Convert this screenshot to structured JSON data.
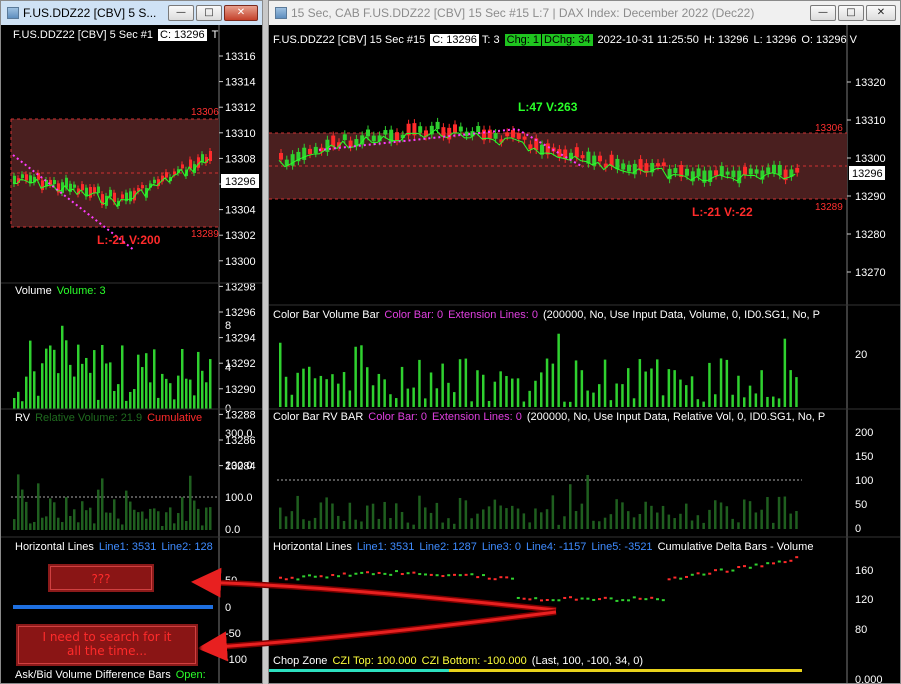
{
  "left_window": {
    "title": "F.US.DDZ22 [CBV]  5 S...",
    "header": {
      "symbol": "F.US.DDZ22 [CBV]  5 Sec   #1",
      "close": "C: 13296",
      "cut": "T"
    },
    "price_axis": [
      "13316",
      "13314",
      "13312",
      "13310",
      "13308",
      "13306",
      "13304",
      "13302",
      "13300",
      "13298",
      "13296",
      "13294",
      "13292",
      "13290",
      "13288",
      "13286",
      "13284"
    ],
    "current_price": "13296",
    "line_label_top": "13306",
    "line_label_bottom": "13289",
    "low_label": "L:-21 V:200",
    "volume": {
      "label": "Volume",
      "value": "Volume: 3",
      "axis": [
        "8",
        "4",
        "0"
      ]
    },
    "rv": {
      "label": "RV",
      "value": "Relative Volume: 21.9",
      "cumulative": "Cumulative",
      "axis": [
        "300.0",
        "200.0",
        "100.0",
        "0.0"
      ]
    },
    "hlines": {
      "label": "Horizontal Lines",
      "line1": "Line1: 3531",
      "line2": "Line2: 128",
      "axis": [
        "50",
        "0",
        "-50",
        "-100"
      ]
    },
    "footer": {
      "label": "Ask/Bid Volume Difference Bars",
      "value": "Open:"
    }
  },
  "right_window": {
    "title": "15 Sec, CAB F.US.DDZ22 [CBV]  15 Sec   #15 L:7 | DAX Index: December 2022 (Dec22)",
    "header": {
      "symbol": "F.US.DDZ22 [CBV]  15 Sec   #15",
      "close": "C: 13296",
      "trades": "T: 3",
      "chg": "Chg: 1",
      "dchg": "DChg: 34",
      "datetime": "2022-10-31  11:25:50",
      "high": "H: 13296",
      "low": "L: 13296",
      "open": "O: 13296 V"
    },
    "price_axis": [
      "13320",
      "13310",
      "13300",
      "13290",
      "13280",
      "13270"
    ],
    "current_price": "13296",
    "line_label_top": "13306",
    "line_label_bottom": "13289",
    "high_label": "L:47 V:263",
    "low_label": "L:-21 V:-22",
    "cbvb": {
      "label": "Color Bar Volume Bar",
      "colorbar": "Color Bar: 0",
      "ext": "Extension Lines: 0",
      "params": "(200000, No, Use Input Data, Volume, 0, ID0.SG1, No, P",
      "axis": [
        "20"
      ]
    },
    "cbrv": {
      "label": "Color Bar RV BAR",
      "colorbar": "Color Bar: 0",
      "ext": "Extension Lines: 0",
      "params": "(200000, No, Use Input Data, Relative Vol, 0, ID0.SG1, No, P",
      "axis": [
        "200",
        "150",
        "100",
        "50",
        "0"
      ]
    },
    "hlines": {
      "label": "Horizontal Lines",
      "l1": "Line1: 3531",
      "l2": "Line2: 1287",
      "l3": "Line3: 0",
      "l4": "Line4: -1157",
      "l5": "Line5: -3521",
      "cum": "Cumulative Delta Bars - Volume",
      "axis": [
        "160",
        "120",
        "80"
      ]
    },
    "chop": {
      "label": "Chop Zone",
      "top": "CZI Top: 100.000",
      "bottom": "CZI Bottom: -100.000",
      "params": "(Last, 100, -100, 34, 0)",
      "axis": [
        "0.000"
      ]
    }
  },
  "annotations": {
    "box1": "???",
    "box2_line1": "I need to search for it",
    "box2_line2": "all the time..."
  },
  "colors": {
    "candle_up": "#2fd12f",
    "candle_down": "#ff2b2b",
    "ma": "#2aff2a",
    "dotted": "#ff3cff",
    "band": "#4a1f1f",
    "accent_blue": "#1e6fe0"
  }
}
